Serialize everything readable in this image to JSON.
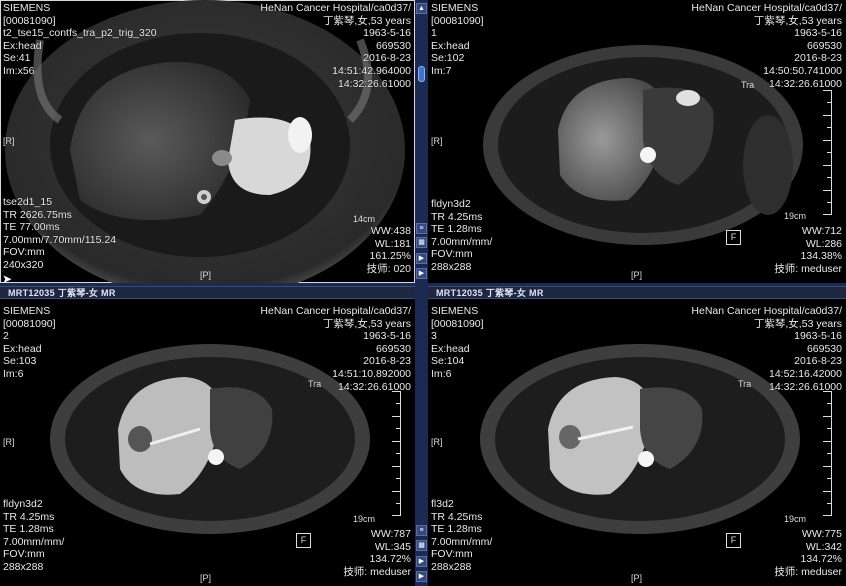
{
  "viewports": [
    {
      "id": "tl",
      "active": true,
      "title_bar": "",
      "tl_lines": [
        "SIEMENS",
        "[00081090]",
        "t2_tse15_contfs_tra_p2_trig_320",
        "Ex:head",
        "Se:41",
        "Im:x56"
      ],
      "tr_lines": [
        "HeNan Cancer Hospital/ca0d37/",
        "丁紫琴,女,53 years",
        "1963-5-16",
        "669530",
        "2016-8-23",
        "14:51:42.964000",
        "14:32:26.61000"
      ],
      "bl_lines": [
        "tse2d1_15",
        "TR 2626.75ms",
        "TE 77.00ms",
        "7.00mm/7.70mm/115.24",
        "FOV:mm",
        "240x320"
      ],
      "br_lines": [
        "WW:438",
        "WL:181",
        "161.25%",
        "技师: 020"
      ],
      "orient_left": "[R]",
      "orient_bottom": "[P]",
      "scale_label": "14cm",
      "f_marker": ""
    },
    {
      "id": "tr",
      "active": false,
      "title_bar": "",
      "tl_lines": [
        "SIEMENS",
        "[00081090]",
        "1",
        "Ex:head",
        "Se:102",
        "Im:7"
      ],
      "tr_lines": [
        "HeNan Cancer Hospital/ca0d37/",
        "丁紫琴,女,53 years",
        "1963-5-16",
        "669530",
        "2016-8-23",
        "14:50:50.741000",
        "14:32:26.61000"
      ],
      "bl_lines": [
        "fldyn3d2",
        "TR 4.25ms",
        "TE 1.28ms",
        "7.00mm/mm/",
        "FOV:mm",
        "288x288"
      ],
      "br_lines": [
        "WW:712",
        "WL:286",
        "134.38%",
        "技师: meduser"
      ],
      "orient_left": "[R]",
      "orient_bottom": "[P]",
      "scale_label": "19cm",
      "f_marker": "F",
      "tra_label": "Tra"
    },
    {
      "id": "bl",
      "active": false,
      "title_bar": "MRT12035 丁紫琴-女 MR",
      "tl_lines": [
        "SIEMENS",
        "[00081090]",
        "2",
        "Ex:head",
        "Se:103",
        "Im:6"
      ],
      "tr_lines": [
        "HeNan Cancer Hospital/ca0d37/",
        "丁紫琴,女,53 years",
        "1963-5-16",
        "669530",
        "2016-8-23",
        "14:51:10.892000",
        "14:32:26.61000"
      ],
      "bl_lines": [
        "fldyn3d2",
        "TR 4.25ms",
        "TE 1.28ms",
        "7.00mm/mm/",
        "FOV:mm",
        "288x288"
      ],
      "br_lines": [
        "WW:787",
        "WL:345",
        "134.72%",
        "技师: meduser"
      ],
      "orient_left": "[R]",
      "orient_bottom": "[P]",
      "scale_label": "19cm",
      "f_marker": "F",
      "tra_label": "Tra"
    },
    {
      "id": "br",
      "active": false,
      "title_bar": "MRT12035 丁紫琴-女 MR",
      "tl_lines": [
        "SIEMENS",
        "[00081090]",
        "3",
        "Ex:head",
        "Se:104",
        "Im:6"
      ],
      "tr_lines": [
        "HeNan Cancer Hospital/ca0d37/",
        "丁紫琴,女,53 years",
        "1963-5-16",
        "669530",
        "2016-8-23",
        "14:52:16.42000",
        "14:32:26.61000"
      ],
      "bl_lines": [
        "fl3d2",
        "TR 4.25ms",
        "TE 1.28ms",
        "7.00mm/mm/",
        "FOV:mm",
        "288x288"
      ],
      "br_lines": [
        "WW:775",
        "WL:342",
        "134.72%",
        "技师: meduser"
      ],
      "orient_left": "[R]",
      "orient_bottom": "[P]",
      "scale_label": "19cm",
      "f_marker": "F",
      "tra_label": "Tra"
    }
  ],
  "toolbar_icons": [
    "scroll-up-icon",
    "scroll-slider-icon",
    "menu-icon",
    "grid-icon",
    "play-icon",
    "play-icon",
    "play-icon"
  ]
}
